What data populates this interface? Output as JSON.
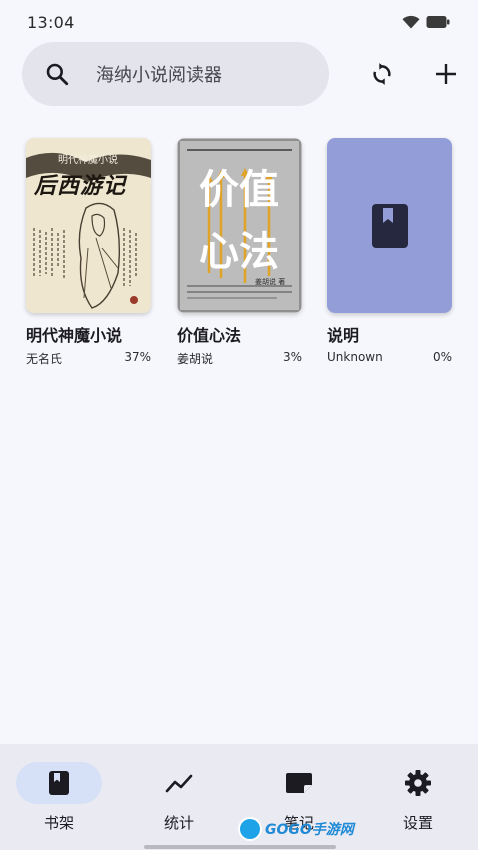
{
  "status_bar": {
    "time": "13:04"
  },
  "search": {
    "placeholder": "海纳小说阅读器"
  },
  "actions": {
    "sync_icon": "sync-icon",
    "add_icon": "add-icon"
  },
  "books": [
    {
      "title": "明代神魔小说",
      "author": "无名氏",
      "progress": "37%",
      "cover_title": "后西游记",
      "cover_top": "明代神魔小说"
    },
    {
      "title": "价值心法",
      "author": "姜胡说",
      "progress": "3%",
      "cover_title_line1": "价值",
      "cover_title_line2": "心法",
      "cover_author": "姜胡说 著"
    },
    {
      "title": "说明",
      "author": "Unknown",
      "progress": "0%",
      "cover_color": "#939ed8"
    }
  ],
  "nav": {
    "items": [
      {
        "label": "书架",
        "icon": "book-icon",
        "active": true
      },
      {
        "label": "统计",
        "icon": "chart-icon"
      },
      {
        "label": "笔记",
        "icon": "note-icon"
      },
      {
        "label": "设置",
        "icon": "gear-icon"
      }
    ]
  },
  "watermark": {
    "text": "GOGO手游网"
  }
}
